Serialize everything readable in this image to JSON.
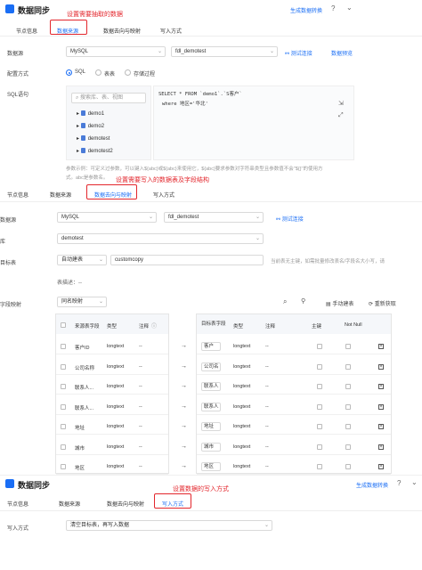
{
  "screen1": {
    "title": "数据同步",
    "annotation": "设置需要抽取的数据",
    "top_right_link": "生成数据转换",
    "tabs": [
      "节点信息",
      "数据来源",
      "数据去向与映射",
      "写入方式"
    ],
    "datasource_label": "数据源",
    "datasource_value": "MySQL",
    "connection_value": "fdl_demotest",
    "test_connection": "测试连接",
    "preview_data": "数据预览",
    "config_label": "配置方式",
    "radio_sql": "SQL",
    "radio_table": "表表",
    "radio_procedure": "存储过程",
    "sql_label": "SQL语句",
    "search_placeholder": "搜索库、表、视图",
    "tree": [
      "demo1",
      "demo2",
      "demotest",
      "demotest2"
    ],
    "sql_line1": "SELECT * FROM `demo1`.`S客户`",
    "sql_line2": "where 地区='华北'",
    "hint_line1": "参数示例：可定义过参数，可以键入${abc}或${abc}来使用它，${abc}要求参数对字符串类型且参数值不会\"${}\"的使用方",
    "hint_line2": "式。abc是参数名。"
  },
  "screen2": {
    "annotation": "设置需要写入的数据表及字段结构",
    "tabs": [
      "节点信息",
      "数据来源",
      "数据去向与映射",
      "写入方式"
    ],
    "datasource_label": "数据源",
    "datasource_value": "MySQL",
    "connection_value": "fdl_demotest",
    "test_connection": "测试连接",
    "db_label": "库",
    "db_value": "demotest",
    "target_label": "目标表",
    "target_mode": "自动建表",
    "target_table": "customcopy",
    "target_hint": "当前表无主键，如需批量修改表名/字段名大小写，请",
    "preview_label": "表描述：",
    "preview_value": "--",
    "mapping_label": "字段映射",
    "mapping_mode": "同名映射",
    "manual_create": "手动建表",
    "refetch": "重新获取",
    "src_headers": [
      "来源表字段",
      "类型",
      "注释"
    ],
    "tgt_headers": [
      "目标表字段",
      "类型",
      "注释",
      "主键",
      "Not Null"
    ],
    "rows": [
      {
        "src": "客户ID",
        "type": "longtext",
        "note": "--",
        "tgt": "客户",
        "ttype": "longtext",
        "tnote": "--"
      },
      {
        "src": "公司名称",
        "type": "longtext",
        "note": "--",
        "tgt": "公司名",
        "ttype": "longtext",
        "tnote": "--"
      },
      {
        "src": "联系人...",
        "type": "longtext",
        "note": "--",
        "tgt": "联系人",
        "ttype": "longtext",
        "tnote": "--"
      },
      {
        "src": "联系人...",
        "type": "longtext",
        "note": "--",
        "tgt": "联系人",
        "ttype": "longtext",
        "tnote": "--"
      },
      {
        "src": "地址",
        "type": "longtext",
        "note": "--",
        "tgt": "地址",
        "ttype": "longtext",
        "tnote": "--"
      },
      {
        "src": "城市",
        "type": "longtext",
        "note": "--",
        "tgt": "城市",
        "ttype": "longtext",
        "tnote": "--"
      },
      {
        "src": "地区",
        "type": "longtext",
        "note": "--",
        "tgt": "地区",
        "ttype": "longtext",
        "tnote": "--"
      }
    ]
  },
  "screen3": {
    "title": "数据同步",
    "annotation": "设置数据的写入方式",
    "top_right_link": "生成数据转换",
    "tabs": [
      "节点信息",
      "数据来源",
      "数据去向与映射",
      "写入方式"
    ],
    "write_label": "写入方式",
    "write_value": "清空目标表，再写入数据"
  },
  "colors": {
    "accent": "#1a6ef5",
    "annotation": "#e3262c"
  }
}
